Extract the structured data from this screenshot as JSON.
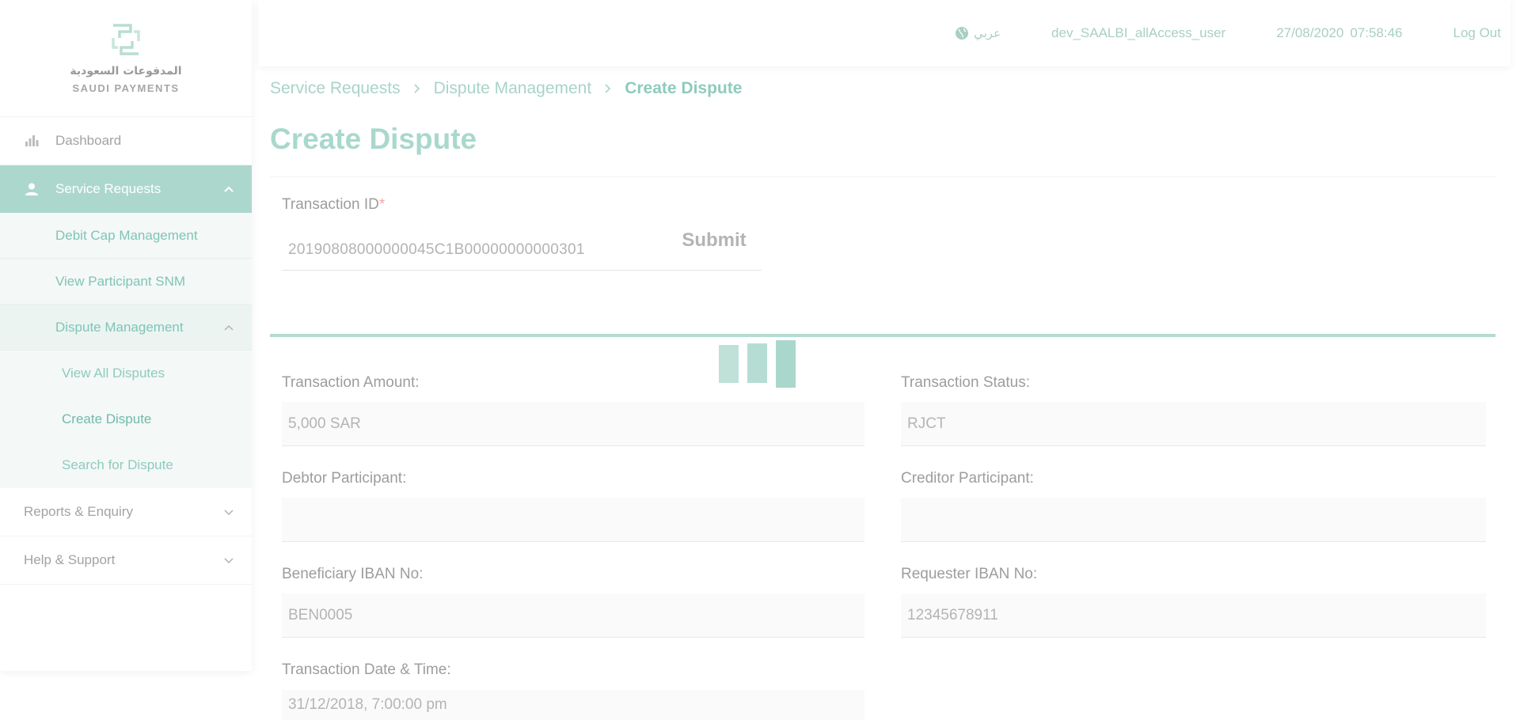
{
  "brand": {
    "arabic_name": "المدفوعات السعودية",
    "english_name": "SAUDI PAYMENTS",
    "accent_color": "#acd7cd"
  },
  "sidebar": {
    "items": [
      {
        "label": "Dashboard",
        "icon": "dashboard-bars-icon"
      },
      {
        "label": "Service Requests",
        "icon": "user-icon",
        "expanded": true
      },
      {
        "label": "Reports & Enquiry",
        "expanded": false
      },
      {
        "label": "Help & Support",
        "expanded": false
      }
    ],
    "service_requests_children": [
      {
        "label": "Debit Cap Management"
      },
      {
        "label": "View Participant SNM"
      },
      {
        "label": "Dispute Management",
        "expanded": true
      }
    ],
    "dispute_children": [
      {
        "label": "View All Disputes"
      },
      {
        "label": "Create Dispute",
        "current": true
      },
      {
        "label": "Search for Dispute"
      }
    ]
  },
  "topbar": {
    "language_label": "عربي",
    "language_icon": "globe-icon",
    "username": "dev_SAALBI_allAccess_user",
    "date": "27/08/2020",
    "time": "07:58:46",
    "logout_label": "Log Out"
  },
  "breadcrumb": {
    "items": [
      "Service Requests",
      "Dispute Management"
    ],
    "current": "Create Dispute"
  },
  "page": {
    "title": "Create Dispute"
  },
  "form": {
    "transaction_id_label": "Transaction ID",
    "required_marker": "*",
    "transaction_id_value": "20190808000000045C1B00000000000301",
    "submit_label": "Submit"
  },
  "details": {
    "transaction_amount": {
      "label": "Transaction Amount:",
      "value": "5,000 SAR"
    },
    "transaction_status": {
      "label": "Transaction Status:",
      "value": "RJCT"
    },
    "debtor_participant": {
      "label": "Debtor Participant:",
      "value": ""
    },
    "creditor_participant": {
      "label": "Creditor Participant:",
      "value": ""
    },
    "beneficiary_iban": {
      "label": "Beneficiary IBAN No:",
      "value": "BEN0005"
    },
    "requester_iban": {
      "label": "Requester IBAN No:",
      "value": "12345678911"
    },
    "transaction_datetime": {
      "label": "Transaction Date & Time:",
      "value": "31/12/2018, 7:00:00 pm"
    }
  }
}
